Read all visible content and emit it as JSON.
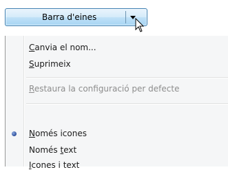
{
  "toolbar": {
    "button_label": "Barra d'eines"
  },
  "menu": {
    "items": [
      {
        "pre": "",
        "key": "C",
        "post": "anvia el nom..."
      },
      {
        "pre": "",
        "key": "S",
        "post": "uprimeix"
      },
      {
        "pre": "",
        "key": "R",
        "post": "estaura la configuració per defecte"
      },
      {
        "pre": "",
        "key": "N",
        "post": "omés icones"
      },
      {
        "pre": "Només ",
        "key": "t",
        "post": "ext"
      },
      {
        "pre": "",
        "key": "I",
        "post": "cones i text"
      }
    ],
    "selected_option": "Només icones"
  },
  "colors": {
    "button_border": "#3c7fb1",
    "menu_background": "#f5f6f7",
    "disabled_text": "#8d8d8d",
    "radio": "#2d4f9a"
  },
  "icons": {
    "dropdown": "chevron-down-icon",
    "cursor": "mouse-pointer-icon",
    "radio": "radio-dot-icon"
  }
}
